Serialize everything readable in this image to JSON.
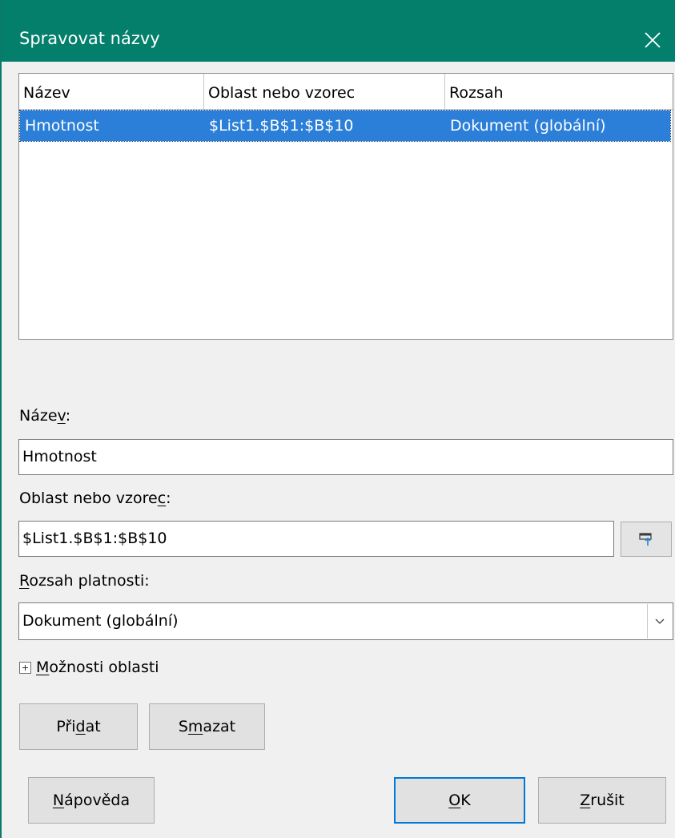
{
  "window": {
    "title": "Spravovat názvy"
  },
  "list": {
    "columns": [
      "Název",
      "Oblast nebo vzorec",
      "Rozsah"
    ],
    "rows": [
      {
        "name": "Hmotnost",
        "range": "$List1.$B$1:$B$10",
        "scope": "Dokument (globální)"
      }
    ]
  },
  "form": {
    "name_label_pre": "Náze",
    "name_label_u": "v",
    "name_label_post": ":",
    "name_value": "Hmotnost",
    "range_label_pre": "Oblast nebo vzore",
    "range_label_u": "c",
    "range_label_post": ":",
    "range_value": "$List1.$B$1:$B$10",
    "scope_label_u": "R",
    "scope_label_post": "ozsah platnosti:",
    "scope_value": "Dokument (globální)",
    "options_u": "M",
    "options_post": "ožnosti oblasti"
  },
  "buttons": {
    "add_pre": "Při",
    "add_u": "d",
    "add_post": "at",
    "delete_pre": "S",
    "delete_u": "m",
    "delete_post": "azat",
    "help_u": "N",
    "help_post": "ápověda",
    "ok_u": "O",
    "ok_post": "K",
    "cancel_u": "Z",
    "cancel_post": "rušit"
  },
  "colors": {
    "titlebar": "#037f6b",
    "selection": "#2b7fd8",
    "default_button_border": "#0078d7"
  },
  "icons": {
    "close": "close-icon",
    "ref": "shrink-dialog-icon",
    "dropdown": "chevron-down-icon",
    "expander": "plus-box-icon"
  }
}
